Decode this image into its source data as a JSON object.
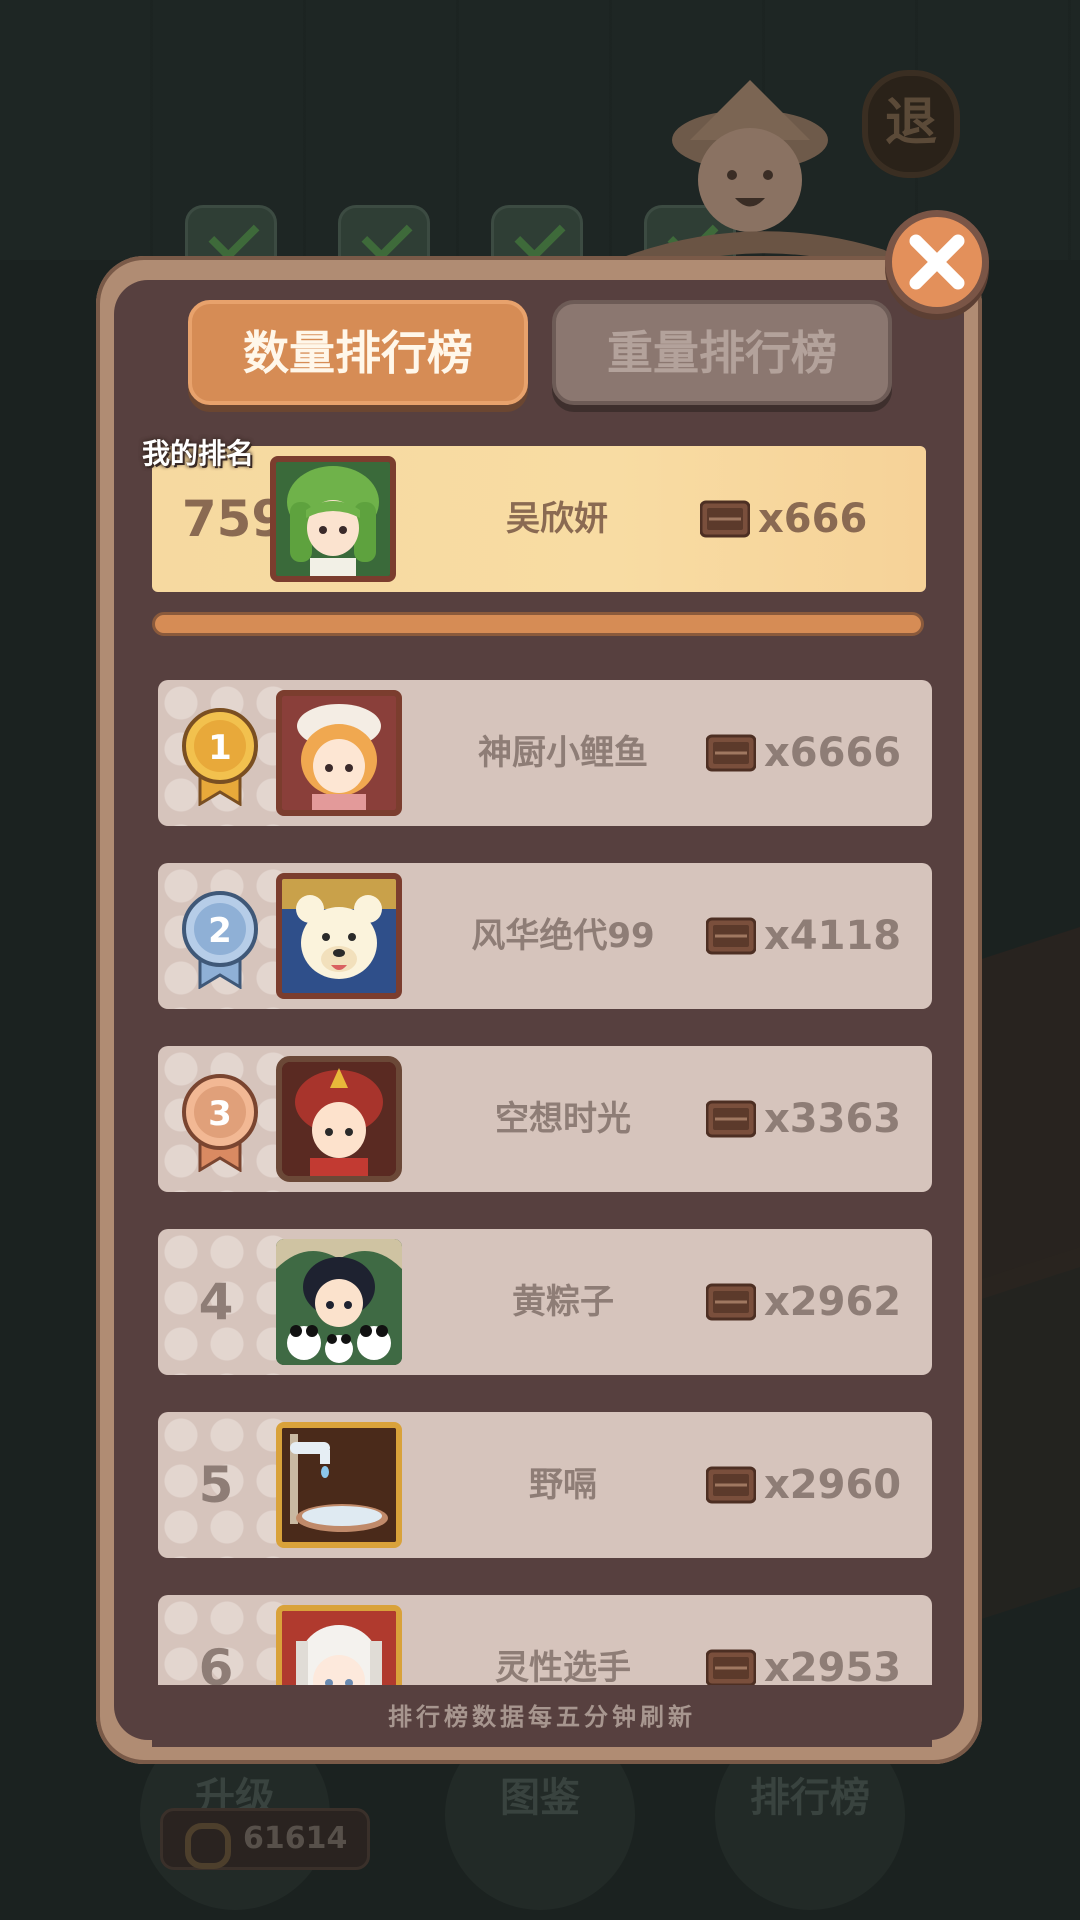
{
  "background": {
    "exit_button_label": "退",
    "bottom_buttons": [
      "升级",
      "图鉴",
      "排行榜"
    ],
    "coin_amount": "61614"
  },
  "tabs": {
    "count_leaderboard": "数量排行榜",
    "weight_leaderboard": "重量排行榜"
  },
  "my_rank": {
    "label": "我的排名",
    "rank": "759",
    "name": "吴欣妍",
    "score": "x666"
  },
  "leaderboard": [
    {
      "rank": "1",
      "name": "神厨小鲤鱼",
      "score": "x6666"
    },
    {
      "rank": "2",
      "name": "风华绝代99",
      "score": "x4118"
    },
    {
      "rank": "3",
      "name": "空想时光",
      "score": "x3363"
    },
    {
      "rank": "4",
      "name": "黄粽子",
      "score": "x2962"
    },
    {
      "rank": "5",
      "name": "野嗝",
      "score": "x2960"
    },
    {
      "rank": "6",
      "name": "灵性选手",
      "score": "x2953"
    }
  ],
  "footer_note": "排行榜数据每五分钟刷新",
  "colors": {
    "accent_orange": "#d68c55",
    "medal_gold": "#e8a93a",
    "medal_silver": "#8fb0d6",
    "medal_bronze": "#e0a07a",
    "highlight_row": "#f6d9a0"
  }
}
